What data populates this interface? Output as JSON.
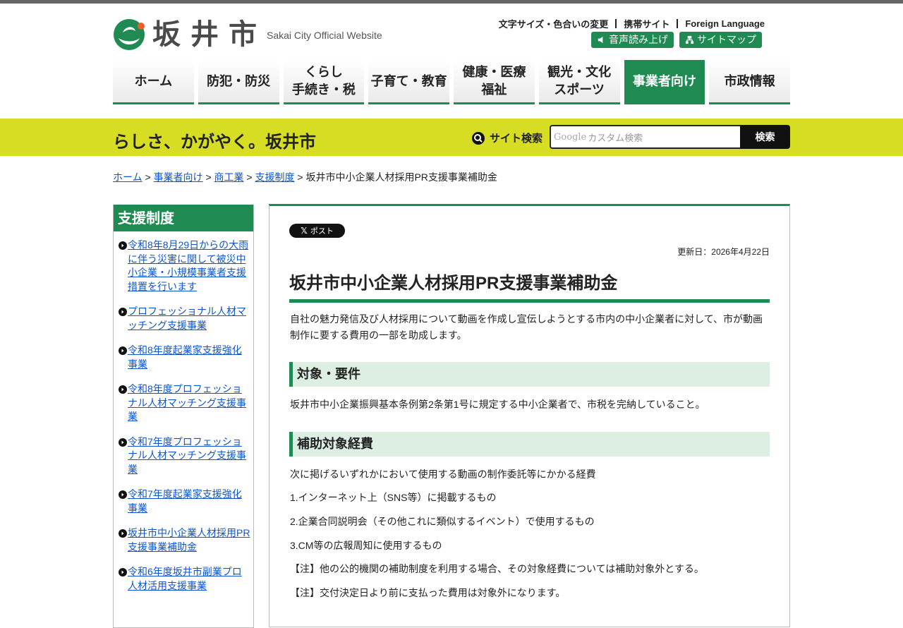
{
  "header": {
    "logo_text": "坂井市",
    "logo_sub": "Sakai City Official Website",
    "util_links": [
      "文字サイズ・色合いの変更",
      "携帯サイト",
      "Foreign Language"
    ],
    "read_aloud": "音声読み上げ",
    "sitemap": "サイトマップ",
    "brand_color": "#1f8a52"
  },
  "nav": {
    "home": "ホーム",
    "safety": "防犯・防災",
    "life_l1": "くらし",
    "life_l2": "手続き・税",
    "child": "子育て・教育",
    "health_l1": "健康・医療",
    "health_l2": "福祉",
    "tour_l1": "観光・文化",
    "tour_l2": "スポーツ",
    "business": "事業者向け",
    "city": "市政情報"
  },
  "banner": {
    "tagline": "らしさ、かがやく。坂井市",
    "search_label": "サイト検索",
    "search_google": "Google",
    "search_placeholder": "カスタム検索",
    "search_button": "検索",
    "color": "#d6dd22"
  },
  "breadcrumb": {
    "items": [
      "ホーム",
      "事業者向け",
      "商工業",
      "支援制度"
    ],
    "current": "坂井市中小企業人材採用PR支援事業補助金",
    "sep": ">"
  },
  "sidebar": {
    "title": "支援制度",
    "items": [
      "令和8年8月29日からの大雨に伴う災害に関して被災中小企業・小規模事業者支援措置を行います",
      "プロフェッショナル人材マッチング支援事業",
      "令和8年度起業家支援強化事業",
      "令和8年度プロフェッショナル人材マッチング支援事業",
      "令和7年度プロフェッショナル人材マッチング支援事業",
      "令和7年度起業家支援強化事業",
      "坂井市中小企業人材採用PR支援事業補助金",
      "令和6年度坂井市副業プロ人材活用支援事業"
    ]
  },
  "main": {
    "x_post": "ポスト",
    "updated": "更新日：2026年4月22日",
    "title": "坂井市中小企業人材採用PR支援事業補助金",
    "intro": "自社の魅力発信及び人材採用について動画を作成し宣伝しようとする市内の中小企業者に対して、市が動画制作に要する費用の一部を助成します。",
    "h_target": "対象・要件",
    "target_text": "坂井市中小企業振興基本条例第2条第1号に規定する中小企業者で、市税を完納していること。",
    "h_cost": "補助対象経費",
    "cost_intro": "次に掲げるいずれかにおいて使用する動画の制作委託等にかかる経費",
    "cost_1": "1.インターネット上（SNS等）に掲載するもの",
    "cost_2": "2.企業合同説明会（その他これに類似するイベント）で使用するもの",
    "cost_3": "3.CM等の広報周知に使用するもの",
    "note_1": "【注】他の公的機関の補助制度を利用する場合、その対象経費については補助対象外とする。",
    "note_2": "【注】交付決定日より前に支払った費用は対象外になります。"
  }
}
